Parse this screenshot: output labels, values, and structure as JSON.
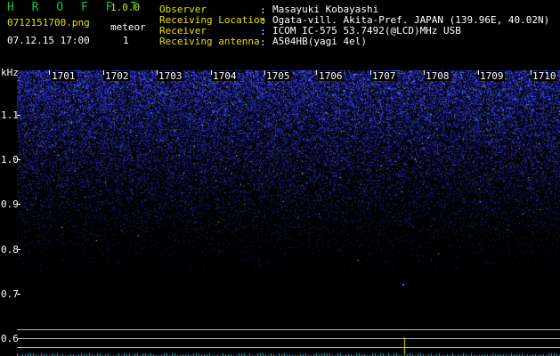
{
  "header": {
    "app_title": "H R O F F T",
    "app_version": "1.0.0",
    "file_name": "0712151700.png",
    "meteor_label": "meteor",
    "datetime": "07.12.15 17:00",
    "meteor_count": "1"
  },
  "info": [
    {
      "label": "Observer",
      "value": "Masayuki Kobayashi"
    },
    {
      "label": "Receiving Location",
      "value": "Ogata-vill. Akita-Pref. JAPAN (139.96E, 40.02N)"
    },
    {
      "label": "Receiver",
      "value": "ICOM IC-575 53.7492(@LCD)MHz USB"
    },
    {
      "label": "Receiving antenna",
      "value": "A504HB(yagi 4el)"
    }
  ],
  "info_separator": ":",
  "chart_data": {
    "type": "heatmap",
    "ylabel": "kHz",
    "yticks": [
      "1.1",
      "1.0",
      "0.9",
      "0.8",
      "0.7",
      "0.6"
    ],
    "xticks": [
      "1701",
      "1702",
      "1703",
      "1704",
      "1705",
      "1706",
      "1707",
      "1708",
      "1709",
      "1710"
    ],
    "colors": {
      "noise_bright": "#4a5cff",
      "noise_dim": "#1a1a9a",
      "meteor": "#e8e000",
      "trace": "#20c0e0"
    }
  }
}
